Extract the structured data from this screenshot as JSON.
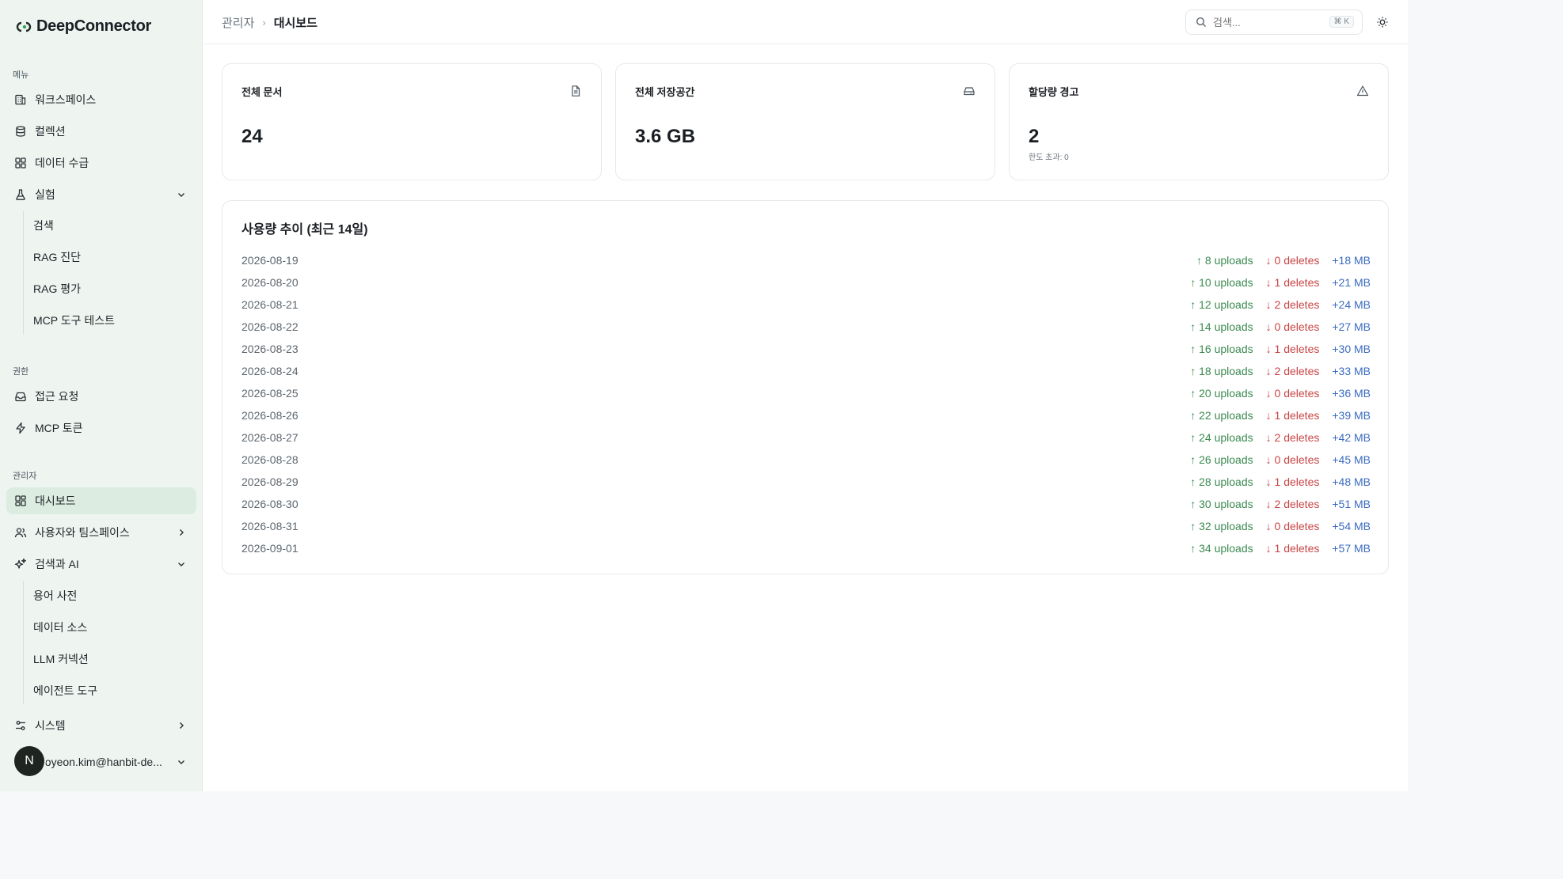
{
  "app": {
    "name": "DeepConnector"
  },
  "sidebar": {
    "menu_label": "메뉴",
    "menu_items": [
      {
        "label": "워크스페이스",
        "icon": "building-icon"
      },
      {
        "label": "컬렉션",
        "icon": "database-icon"
      },
      {
        "label": "데이터 수급",
        "icon": "grid-icon"
      },
      {
        "label": "실험",
        "icon": "flask-icon"
      }
    ],
    "experiment_sub": [
      "검색",
      "RAG 진단",
      "RAG 평가",
      "MCP 도구 테스트"
    ],
    "permissions_label": "권한",
    "permission_items": [
      {
        "label": "접근 요청",
        "icon": "inbox-icon"
      },
      {
        "label": "MCP 토큰",
        "icon": "zap-icon"
      }
    ],
    "admin_label": "관리자",
    "admin_items": [
      {
        "label": "대시보드",
        "icon": "dashboard-icon"
      },
      {
        "label": "사용자와 팀스페이스",
        "icon": "users-icon"
      },
      {
        "label": "검색과 AI",
        "icon": "sparkles-icon"
      }
    ],
    "search_ai_sub": [
      "용어 사전",
      "데이터 소스",
      "LLM 커넥션",
      "에이전트 도구"
    ],
    "system_label": "시스템",
    "user": {
      "initial": "N",
      "email": "seoyeon.kim@hanbit-de..."
    }
  },
  "header": {
    "breadcrumb_parent": "관리자",
    "breadcrumb_current": "대시보드",
    "search_placeholder": "검색...",
    "search_shortcut": "⌘ K"
  },
  "cards": [
    {
      "label": "전체 문서",
      "value": "24",
      "sub": "",
      "icon": "file-icon"
    },
    {
      "label": "전체 저장공간",
      "value": "3.6 GB",
      "sub": "",
      "icon": "hard-drive-icon"
    },
    {
      "label": "할당량 경고",
      "value": "2",
      "sub": "한도 초과: 0",
      "icon": "warning-icon"
    }
  ],
  "usage": {
    "title": "사용량 추이 (최근 14일)",
    "rows": [
      {
        "date": "2026-08-19",
        "uploads": "↑ 8 uploads",
        "deletes": "↓ 0 deletes",
        "size": "+18 MB"
      },
      {
        "date": "2026-08-20",
        "uploads": "↑ 10 uploads",
        "deletes": "↓ 1 deletes",
        "size": "+21 MB"
      },
      {
        "date": "2026-08-21",
        "uploads": "↑ 12 uploads",
        "deletes": "↓ 2 deletes",
        "size": "+24 MB"
      },
      {
        "date": "2026-08-22",
        "uploads": "↑ 14 uploads",
        "deletes": "↓ 0 deletes",
        "size": "+27 MB"
      },
      {
        "date": "2026-08-23",
        "uploads": "↑ 16 uploads",
        "deletes": "↓ 1 deletes",
        "size": "+30 MB"
      },
      {
        "date": "2026-08-24",
        "uploads": "↑ 18 uploads",
        "deletes": "↓ 2 deletes",
        "size": "+33 MB"
      },
      {
        "date": "2026-08-25",
        "uploads": "↑ 20 uploads",
        "deletes": "↓ 0 deletes",
        "size": "+36 MB"
      },
      {
        "date": "2026-08-26",
        "uploads": "↑ 22 uploads",
        "deletes": "↓ 1 deletes",
        "size": "+39 MB"
      },
      {
        "date": "2026-08-27",
        "uploads": "↑ 24 uploads",
        "deletes": "↓ 2 deletes",
        "size": "+42 MB"
      },
      {
        "date": "2026-08-28",
        "uploads": "↑ 26 uploads",
        "deletes": "↓ 0 deletes",
        "size": "+45 MB"
      },
      {
        "date": "2026-08-29",
        "uploads": "↑ 28 uploads",
        "deletes": "↓ 1 deletes",
        "size": "+48 MB"
      },
      {
        "date": "2026-08-30",
        "uploads": "↑ 30 uploads",
        "deletes": "↓ 2 deletes",
        "size": "+51 MB"
      },
      {
        "date": "2026-08-31",
        "uploads": "↑ 32 uploads",
        "deletes": "↓ 0 deletes",
        "size": "+54 MB"
      },
      {
        "date": "2026-09-01",
        "uploads": "↑ 34 uploads",
        "deletes": "↓ 1 deletes",
        "size": "+57 MB"
      }
    ]
  },
  "colors": {
    "sidebar_bg": "#eef5f0",
    "active_bg": "#dcece1",
    "upload": "#3b8a50",
    "delete": "#c94444",
    "size": "#3a6bc0"
  }
}
